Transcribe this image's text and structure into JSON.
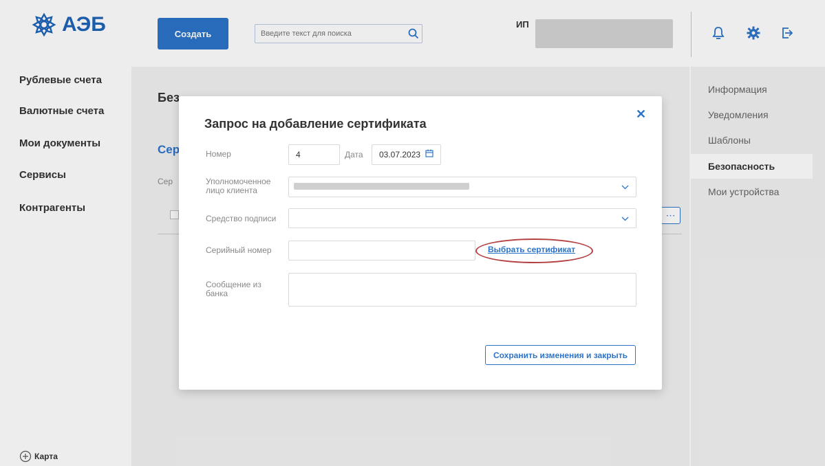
{
  "header": {
    "logo_text": "АЭБ",
    "create_label": "Создать",
    "search_placeholder": "Введите текст для поиска",
    "org_prefix": "ИП",
    "icons": [
      "bell-icon",
      "gear-icon",
      "logout-icon"
    ]
  },
  "nav": {
    "items": [
      "Рублевые счета",
      "Валютные счета",
      "Мои документы",
      "Сервисы",
      "Контрагенты"
    ],
    "map_label": "Карта"
  },
  "right_menu": {
    "items": [
      "Информация",
      "Уведомления",
      "Шаблоны",
      "Безопасность",
      "Мои устройства"
    ],
    "active": "Безопасность"
  },
  "page": {
    "title_partial": "Без",
    "subtitle_partial": "Сер",
    "column_partial": "Сер"
  },
  "modal": {
    "title": "Запрос на добавление сертификата",
    "number_label": "Номер",
    "number_value": "4",
    "date_label": "Дата",
    "date_value": "03.07.2023",
    "authorized_label": "Уполномоченное лицо клиента",
    "signature_label": "Средство подписи",
    "serial_label": "Серийный номер",
    "select_cert_label": "Выбрать сертификат",
    "bank_message_label": "Сообщение из банка",
    "save_label": "Сохранить изменения и закрыть"
  },
  "colors": {
    "accent": "#2c74c9",
    "highlight": "#b54040"
  }
}
